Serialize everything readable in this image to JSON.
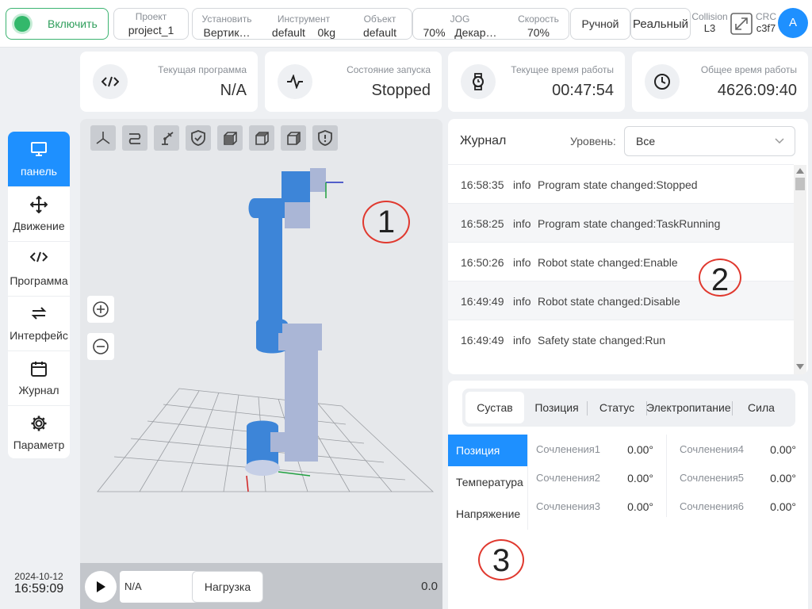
{
  "topbar": {
    "enable_label": "Включить",
    "project": {
      "title": "Проект",
      "value": "project_1"
    },
    "install": {
      "title": "Установить",
      "value": "Вертик…"
    },
    "tool": {
      "title": "Инструмент",
      "value": "default",
      "value2": "0kg"
    },
    "object": {
      "title": "Объект",
      "value": "default"
    },
    "jog": {
      "title": "JOG",
      "value": "70%",
      "value2": "Декар…"
    },
    "speed": {
      "title": "Скорость",
      "value": "70%"
    },
    "mode": "Ручной",
    "real": "Реальный",
    "collision": {
      "title": "Collision",
      "value": "L3"
    },
    "crc": {
      "title": "CRC",
      "value": "c3f7"
    },
    "avatar": "A"
  },
  "cards": {
    "program": {
      "title": "Текущая программа",
      "value": "N/A",
      "icon": "code-icon"
    },
    "run_state": {
      "title": "Состояние запуска",
      "value": "Stopped",
      "icon": "pulse-icon"
    },
    "current_time": {
      "title": "Текущее время работы",
      "value": "00:47:54",
      "icon": "watch-icon"
    },
    "total_time": {
      "title": "Общее время работы",
      "value": "4626:09:40",
      "icon": "clock-icon"
    }
  },
  "sidenav": {
    "items": [
      {
        "label": "панель",
        "icon": "monitor-icon",
        "active": true
      },
      {
        "label": "Движение",
        "icon": "move-icon"
      },
      {
        "label": "Программа",
        "icon": "code-icon"
      },
      {
        "label": "Интерфейс",
        "icon": "swap-icon"
      },
      {
        "label": "Журнал",
        "icon": "calendar-icon"
      },
      {
        "label": "Параметр",
        "icon": "gear-icon"
      }
    ]
  },
  "datetime": {
    "date": "2024-10-12",
    "time": "16:59:09"
  },
  "viewport": {
    "program_name": "N/A",
    "load_button": "Нагрузка",
    "speed_value": "0.0"
  },
  "log": {
    "title": "Журнал",
    "level_label": "Уровень:",
    "level_value": "Все",
    "rows": [
      {
        "time": "16:58:35",
        "level": "info",
        "message": "Program state changed:Stopped"
      },
      {
        "time": "16:58:25",
        "level": "info",
        "message": "Program state changed:TaskRunning"
      },
      {
        "time": "16:50:26",
        "level": "info",
        "message": "Robot state changed:Enable"
      },
      {
        "time": "16:49:49",
        "level": "info",
        "message": "Robot state changed:Disable"
      },
      {
        "time": "16:49:49",
        "level": "info",
        "message": "Safety state changed:Run"
      }
    ]
  },
  "joints": {
    "tabs": [
      "Сустав",
      "Позиция",
      "Статус",
      "Электропитание",
      "Сила"
    ],
    "vtabs": [
      "Позиция",
      "Температура",
      "Напряжение"
    ],
    "left": [
      {
        "label": "Сочленения1",
        "value": "0.00°"
      },
      {
        "label": "Сочленения2",
        "value": "0.00°"
      },
      {
        "label": "Сочленения3",
        "value": "0.00°"
      }
    ],
    "right": [
      {
        "label": "Сочленения4",
        "value": "0.00°"
      },
      {
        "label": "Сочленения5",
        "value": "0.00°"
      },
      {
        "label": "Сочленения6",
        "value": "0.00°"
      }
    ]
  },
  "callouts": [
    "1",
    "2",
    "3"
  ],
  "colors": {
    "accent": "#1e90ff",
    "enable_green": "#33b86b",
    "robot_blue": "#3d85d8",
    "callout_red": "#e0392f"
  }
}
